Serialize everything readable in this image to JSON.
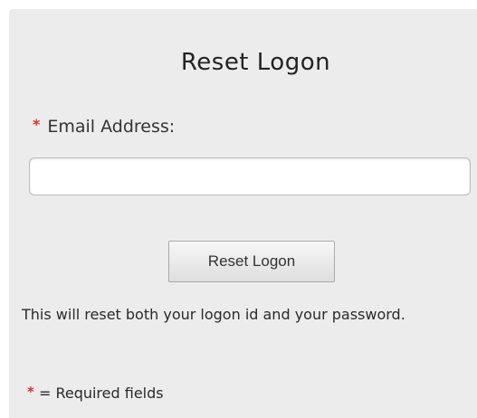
{
  "form": {
    "title": "Reset Logon",
    "required_marker": "*",
    "email_label": "Email Address:",
    "email_value": "",
    "email_placeholder": "",
    "submit_label": "Reset Logon",
    "info_text": "This will reset both your logon id and your password.",
    "legend_text": "= Required fields"
  },
  "colors": {
    "panel_background": "#ececec",
    "required_marker": "#d9312b",
    "text": "#333333"
  }
}
